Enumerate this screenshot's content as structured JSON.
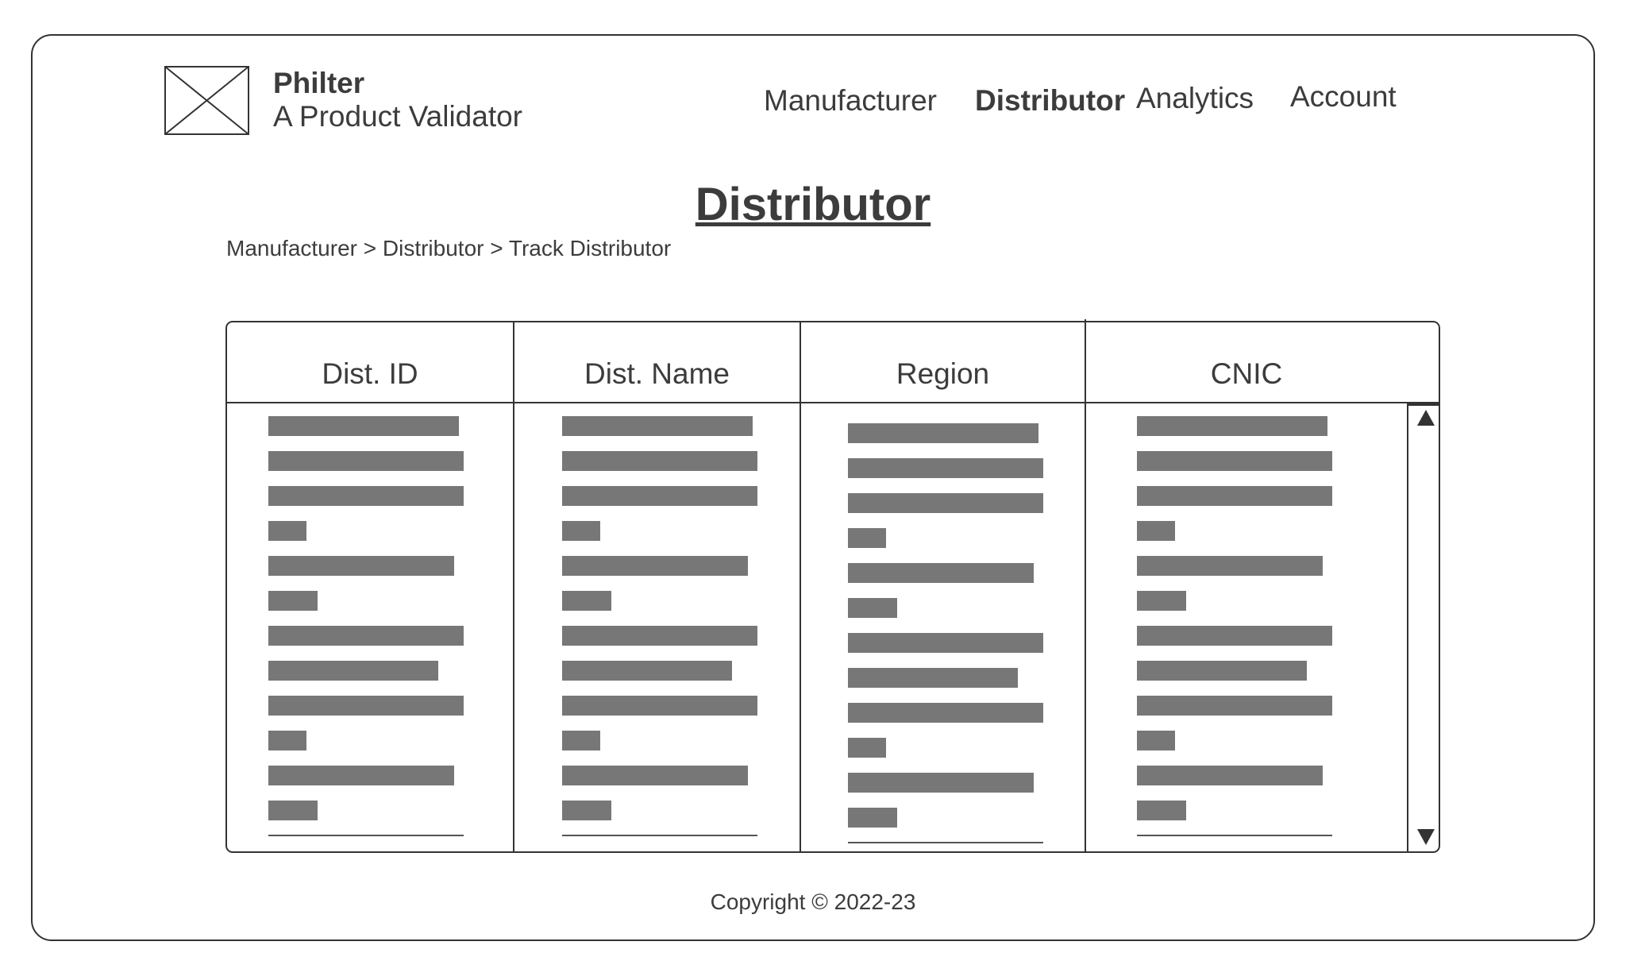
{
  "brand": {
    "name": "Philter",
    "tagline": "A Product Validator",
    "logo_icon": "image-placeholder-icon"
  },
  "nav": {
    "items": [
      {
        "label": "Manufacturer",
        "active": false
      },
      {
        "label": "Distributor",
        "active": true
      },
      {
        "label": "Analytics",
        "active": false
      },
      {
        "label": "Account",
        "active": false
      }
    ]
  },
  "page": {
    "title": "Distributor",
    "breadcrumb": [
      "Manufacturer",
      "Distributor",
      "Track Distributor"
    ],
    "breadcrumb_separator": ">"
  },
  "table": {
    "columns": [
      "Dist. ID",
      "Dist. Name",
      "Region",
      "CNIC"
    ],
    "placeholder_row_count": 12,
    "scroll_up_icon": "triangle-up-icon",
    "scroll_down_icon": "triangle-down-icon"
  },
  "footer": {
    "copyright": "Copyright © 2022-23"
  },
  "colors": {
    "text": "#3c3c3c",
    "border": "#333333",
    "placeholder_bar": "#777777",
    "background": "#ffffff"
  }
}
